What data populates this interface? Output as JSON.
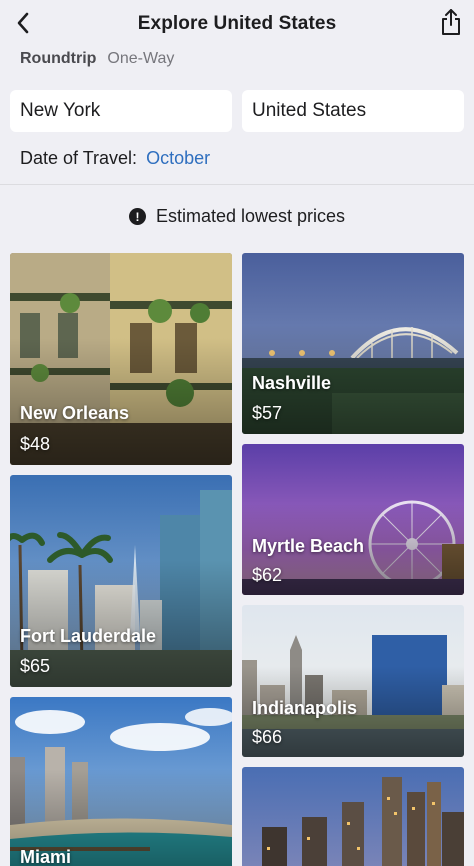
{
  "header": {
    "title": "Explore United States",
    "back_icon": "chevron-left-icon",
    "share_icon": "share-icon"
  },
  "trip_type": {
    "options": [
      "Roundtrip",
      "One-Way"
    ],
    "selected": "Roundtrip"
  },
  "search": {
    "origin": "New York",
    "destination": "United States"
  },
  "date": {
    "label": "Date of Travel:",
    "value": "October"
  },
  "notice": {
    "icon": "exclamation-circle-icon",
    "text": "Estimated lowest prices"
  },
  "destinations": [
    {
      "city": "New Orleans",
      "price": "$48"
    },
    {
      "city": "Nashville",
      "price": "$57"
    },
    {
      "city": "Fort Lauderdale",
      "price": "$65"
    },
    {
      "city": "Myrtle Beach",
      "price": "$62"
    },
    {
      "city": "Indianapolis",
      "price": "$66"
    },
    {
      "city": "Miami",
      "price": ""
    },
    {
      "city": "",
      "price": ""
    }
  ],
  "colors": {
    "accent": "#2f6fbf",
    "background": "#efeff4",
    "card_background": "#ffffff"
  }
}
